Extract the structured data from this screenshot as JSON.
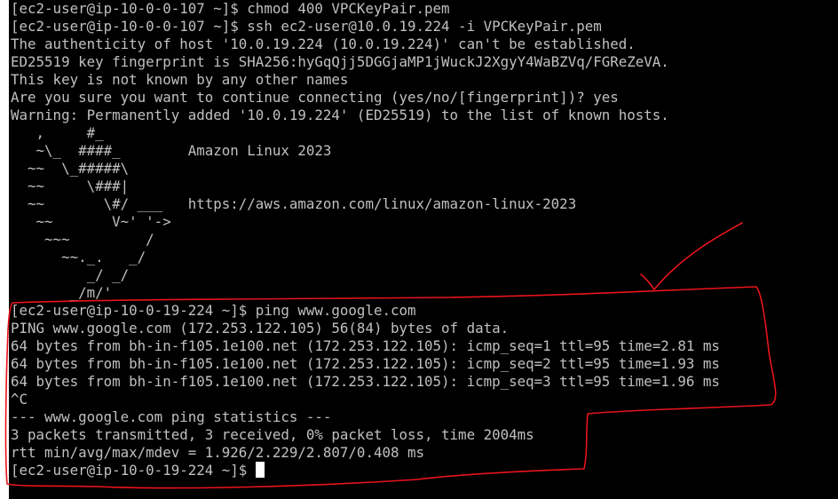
{
  "terminal": {
    "lines": [
      "[ec2-user@ip-10-0-0-107 ~]$ chmod 400 VPCKeyPair.pem",
      "[ec2-user@ip-10-0-0-107 ~]$ ssh ec2-user@10.0.19.224 -i VPCKeyPair.pem",
      "The authenticity of host '10.0.19.224 (10.0.19.224)' can't be established.",
      "ED25519 key fingerprint is SHA256:hyGqQjj5DGGjaMP1jWuckJ2XgyY4WaBZVq/FGReZeVA.",
      "This key is not known by any other names",
      "Are you sure you want to continue connecting (yes/no/[fingerprint])? yes",
      "Warning: Permanently added '10.0.19.224' (ED25519) to the list of known hosts.",
      "   ,     #_",
      "   ~\\_  ####_        Amazon Linux 2023",
      "  ~~  \\_#####\\",
      "  ~~     \\###|",
      "  ~~       \\#/ ___   https://aws.amazon.com/linux/amazon-linux-2023",
      "   ~~       V~' '->",
      "    ~~~         /",
      "      ~~._.   _/",
      "         _/ _/",
      "       _/m/'",
      "[ec2-user@ip-10-0-19-224 ~]$ ping www.google.com",
      "PING www.google.com (172.253.122.105) 56(84) bytes of data.",
      "64 bytes from bh-in-f105.1e100.net (172.253.122.105): icmp_seq=1 ttl=95 time=2.81 ms",
      "64 bytes from bh-in-f105.1e100.net (172.253.122.105): icmp_seq=2 ttl=95 time=1.93 ms",
      "64 bytes from bh-in-f105.1e100.net (172.253.122.105): icmp_seq=3 ttl=95 time=1.96 ms",
      "^C",
      "--- www.google.com ping statistics ---",
      "3 packets transmitted, 3 received, 0% packet loss, time 2004ms",
      "rtt min/avg/max/mdev = 1.926/2.229/2.807/0.408 ms",
      "[ec2-user@ip-10-0-19-224 ~]$ "
    ],
    "background": "#000000",
    "text_color": "#c0c0c0",
    "cursor_color": "#ffffff"
  },
  "annotation": {
    "color": "#e8141b",
    "shapes": [
      "freehand-circle",
      "checkmark"
    ]
  }
}
